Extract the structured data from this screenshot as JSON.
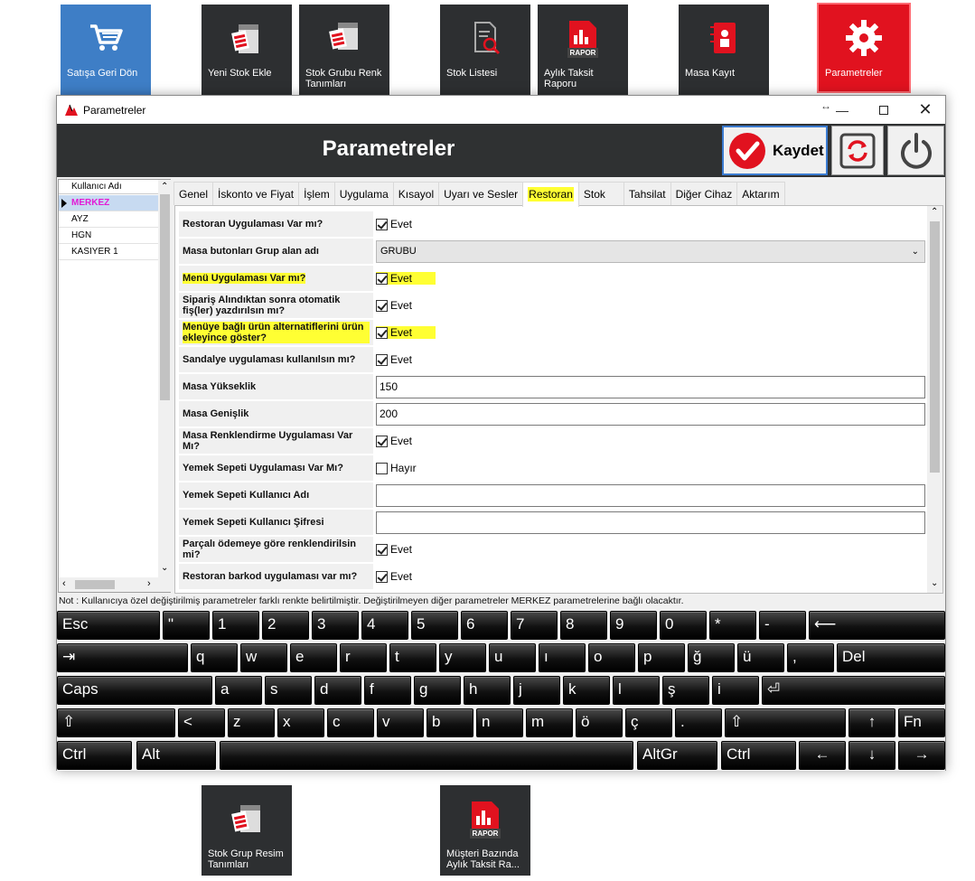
{
  "desktop_tiles": [
    {
      "label": "Satışa Geri Dön",
      "icon": "cart-icon",
      "color": "#3e7ec6"
    },
    {
      "label": "Yeni Stok Ekle",
      "icon": "stock-add-icon"
    },
    {
      "label": "Stok Grubu Renk Tanımları",
      "icon": "stock-group-icon"
    },
    {
      "label": "Stok Listesi",
      "icon": "stock-list-icon"
    },
    {
      "label": "Aylık Taksit Raporu",
      "icon": "report-icon"
    },
    {
      "label": "Masa Kayıt",
      "icon": "table-record-icon"
    },
    {
      "label": "Parametreler",
      "icon": "gear-icon",
      "color": "#e1121f"
    },
    {
      "label": "Stok Grup Resim Tanımları",
      "icon": "stock-image-icon"
    },
    {
      "label": "Müşteri Bazında Aylık Taksit Ra...",
      "icon": "report-icon"
    }
  ],
  "report_badge": "RAPOR",
  "window": {
    "title": "Parametreler",
    "header_title": "Parametreler",
    "save_label": "Kaydet"
  },
  "users": {
    "header": "Kullanıcı Adı",
    "items": [
      "MERKEZ",
      "AYZ",
      "HGN",
      "KASIYER 1"
    ],
    "selected": "MERKEZ"
  },
  "tabs": [
    "Genel",
    "İskonto ve Fiyat",
    "İşlem",
    "Uygulama",
    "Kısayol",
    "Uyarı ve Sesler",
    "Restoran",
    "Stok",
    "Tahsilat",
    "Diğer Cihaz",
    "Aktarım"
  ],
  "active_tab": "Restoran",
  "params": [
    {
      "label": "Restoran Uygulaması Var mı?",
      "type": "checkbox",
      "checked": true,
      "value": "Evet"
    },
    {
      "label": "Masa butonları Grup alan adı",
      "type": "combo",
      "value": "GRUBU"
    },
    {
      "label": "Menü Uygulaması Var mı?",
      "type": "checkbox",
      "checked": true,
      "value": "Evet",
      "highlight": true
    },
    {
      "label": "Sipariş Alındıktan sonra otomatik fiş(ler) yazdırılsın mı?",
      "type": "checkbox",
      "checked": true,
      "value": "Evet"
    },
    {
      "label": "Menüye bağlı ürün alternatiflerini ürün ekleyince göster?",
      "type": "checkbox",
      "checked": true,
      "value": "Evet",
      "highlight": true
    },
    {
      "label": "Sandalye uygulaması kullanılsın mı?",
      "type": "checkbox",
      "checked": true,
      "value": "Evet"
    },
    {
      "label": "Masa Yükseklik",
      "type": "text",
      "value": "150"
    },
    {
      "label": "Masa Genişlik",
      "type": "text",
      "value": "200"
    },
    {
      "label": "Masa Renklendirme Uygulaması Var Mı?",
      "type": "checkbox",
      "checked": true,
      "value": "Evet"
    },
    {
      "label": "Yemek Sepeti Uygulaması Var Mı?",
      "type": "checkbox",
      "checked": false,
      "value": "Hayır"
    },
    {
      "label": "Yemek Sepeti Kullanıcı Adı",
      "type": "text",
      "value": ""
    },
    {
      "label": "Yemek Sepeti Kullanıcı Şifresi",
      "type": "text",
      "value": ""
    },
    {
      "label": "Parçalı ödemeye göre renklendirilsin mi?",
      "type": "checkbox",
      "checked": true,
      "value": "Evet"
    },
    {
      "label": "Restoran barkod uygulaması var mı?",
      "type": "checkbox",
      "checked": true,
      "value": "Evet"
    }
  ],
  "note": "Not : Kullanıcıya özel değiştirilmiş parametreler farklı renkte belirtilmiştir. Değiştirilmeyen diğer parametreler MERKEZ parametrelerine bağlı olacaktır.",
  "keyboard": {
    "row1": [
      "Esc",
      "\"",
      "1",
      "2",
      "3",
      "4",
      "5",
      "6",
      "7",
      "8",
      "9",
      "0",
      "*",
      "-",
      "⟵"
    ],
    "row2": [
      "⇥",
      "q",
      "w",
      "e",
      "r",
      "t",
      "y",
      "u",
      "ı",
      "o",
      "p",
      "ğ",
      "ü",
      ",",
      "Del"
    ],
    "row3": [
      "Caps",
      "a",
      "s",
      "d",
      "f",
      "g",
      "h",
      "j",
      "k",
      "l",
      "ş",
      "i",
      "⏎"
    ],
    "row4": [
      "⇧",
      "<",
      "z",
      "x",
      "c",
      "v",
      "b",
      "n",
      "m",
      "ö",
      "ç",
      ".",
      "⇧",
      "↑",
      "Fn"
    ],
    "row5": [
      "Ctrl",
      "Alt",
      "",
      "AltGr",
      "Ctrl",
      "←",
      "↓",
      "→"
    ]
  }
}
